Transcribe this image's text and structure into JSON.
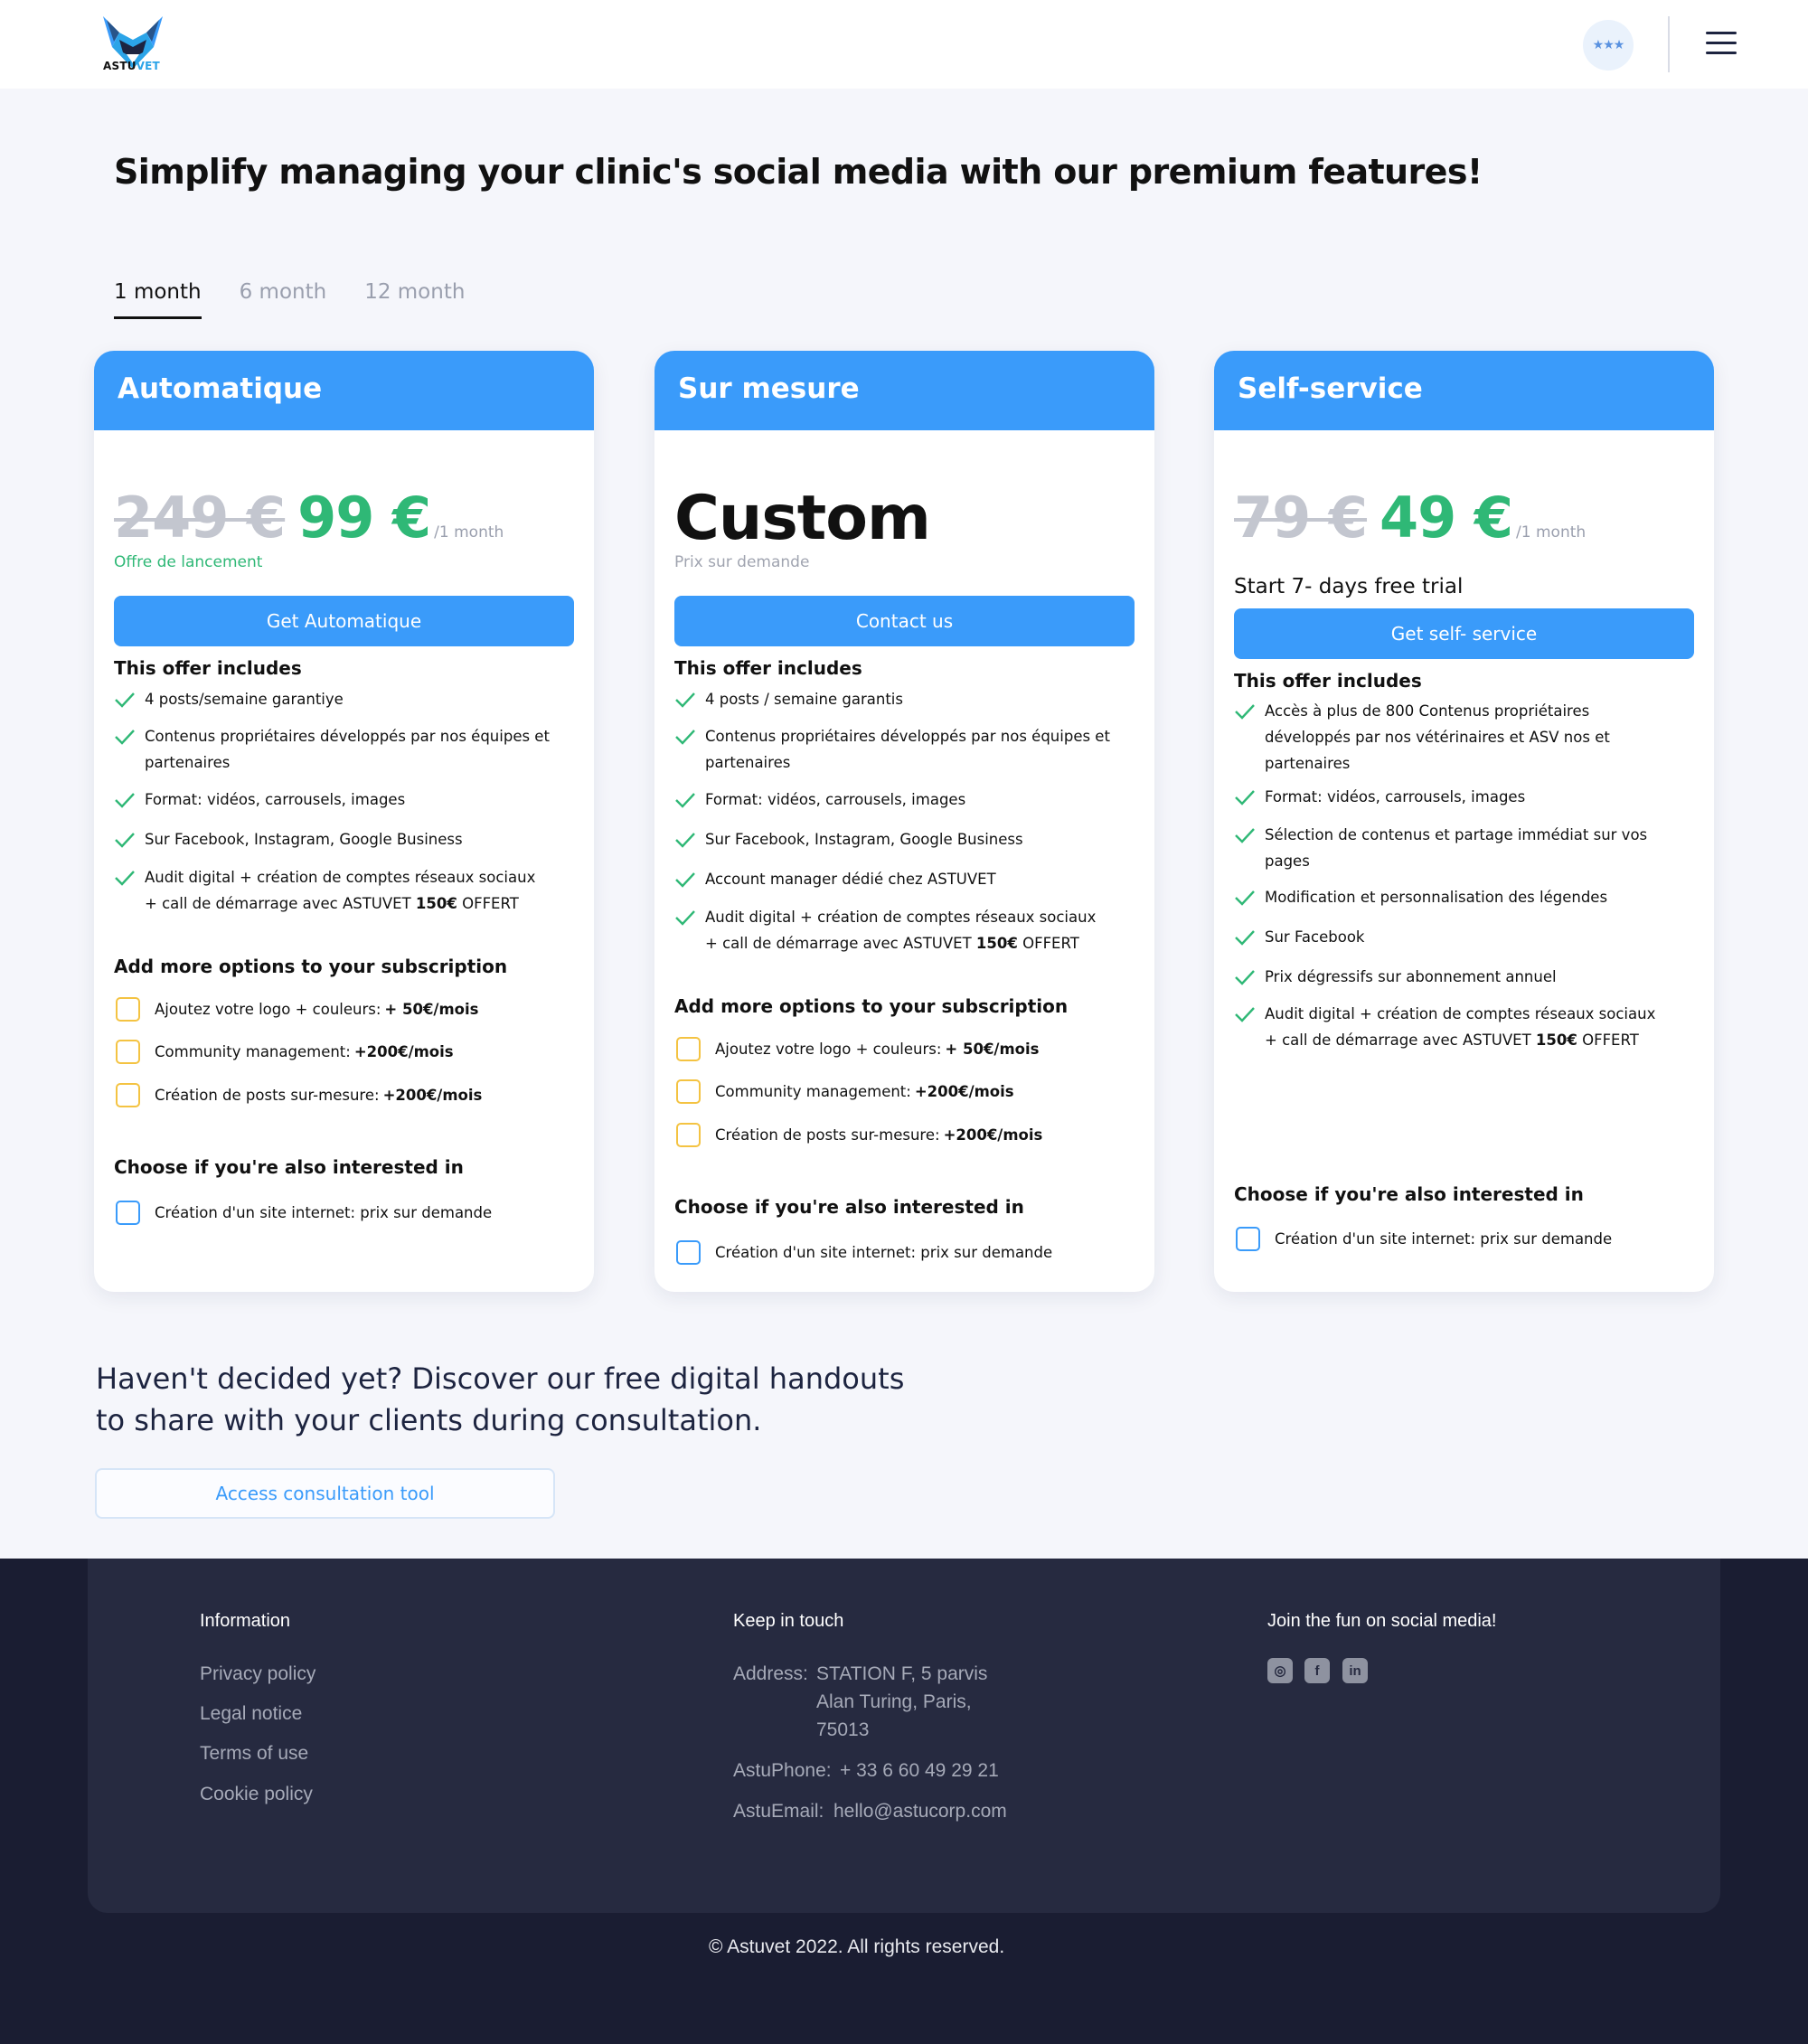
{
  "header": {
    "logo_prefix": "ASTU",
    "logo_suffix": "VET",
    "rating_stars": "★★★"
  },
  "title": "Simplify managing your clinic's social media with our premium features!",
  "tabs": [
    "1 month",
    "6 month",
    "12 month"
  ],
  "active_tab": 0,
  "colors": {
    "accent": "#3a9bfa",
    "price_green": "#2fb876",
    "option_yellow": "#f4c342",
    "footer_dark": "#1a1d32"
  },
  "plans": [
    {
      "name": "Automatique",
      "old_price": "249 €",
      "price": "99 €",
      "period": "/1 month",
      "note": "Offre de lancement",
      "cta": "Get Automatique",
      "includes_title": "This offer includes",
      "features": [
        [
          "4 posts/semaine garantiye"
        ],
        [
          "Contenus propriétaires développés par nos équipes et",
          "partenaires"
        ],
        [
          "Format: vidéos, carrousels, images"
        ],
        [
          "Sur Facebook, Instagram, Google Business"
        ],
        [
          "Audit digital + création de comptes réseaux sociaux",
          "+ call de démarrage avec ASTUVET "
        ]
      ],
      "feature_bold_tail": "150€",
      "feature_tail": " OFFERT",
      "options_title": "Add more options to your subscription",
      "options": [
        {
          "text": "Ajoutez votre logo + couleurs: ",
          "bold": "+ 50€/mois"
        },
        {
          "text": "Community management: ",
          "bold": "+200€/mois"
        },
        {
          "text": "Création de posts sur-mesure: ",
          "bold": "+200€/mois"
        }
      ],
      "interest_title": "Choose if you're  also interested in",
      "interest": "Création d'un site internet: prix sur demande"
    },
    {
      "name": "Sur mesure",
      "custom_price": "Custom",
      "note": "Prix sur demande",
      "cta": "Contact us",
      "includes_title": "This offer includes",
      "features": [
        [
          "4 posts / semaine garantis"
        ],
        [
          "Contenus propriétaires développés par nos équipes et",
          "partenaires"
        ],
        [
          "Format: vidéos, carrousels, images"
        ],
        [
          "Sur Facebook, Instagram, Google Business"
        ],
        [
          "Account manager dédié chez ASTUVET"
        ],
        [
          "Audit digital + création de comptes réseaux sociaux",
          "+ call de démarrage avec ASTUVET "
        ]
      ],
      "feature_bold_tail": "150€",
      "feature_tail": " OFFERT",
      "options_title": "Add more options to your subscription",
      "options": [
        {
          "text": "Ajoutez votre logo + couleurs: ",
          "bold": "+ 50€/mois"
        },
        {
          "text": "Community management: ",
          "bold": "+200€/mois"
        },
        {
          "text": "Création de posts sur-mesure: ",
          "bold": "+200€/mois"
        }
      ],
      "interest_title": "Choose if you're  also interested in",
      "interest": "Création d'un site internet: prix sur demande"
    },
    {
      "name": "Self-service",
      "old_price": "79 €",
      "price": "49 €",
      "period": "/1 month",
      "trial": "Start 7- days free trial",
      "cta": "Get self- service",
      "includes_title": "This offer includes",
      "features": [
        [
          "Accès à plus de 800 Contenus propriétaires",
          "développés par nos vétérinaires et ASV nos et",
          "partenaires"
        ],
        [
          "Format: vidéos, carrousels, images"
        ],
        [
          "Sélection de contenus et partage immédiat sur vos",
          "pages"
        ],
        [
          "Modification et personnalisation des légendes"
        ],
        [
          "Sur Facebook"
        ],
        [
          "Prix dégressifs sur abonnement annuel"
        ],
        [
          "Audit digital + création de comptes réseaux sociaux",
          "+ call de démarrage avec ASTUVET "
        ]
      ],
      "feature_bold_tail": "150€",
      "feature_tail": " OFFERT",
      "interest_title": "Choose if you're  also interested in",
      "interest": "Création d'un site internet: prix sur demande"
    }
  ],
  "help": {
    "line1": "Haven't decided yet? Discover our free digital handouts",
    "line2": "to share with your clients during consultation.",
    "button": "Access consultation tool"
  },
  "footer": {
    "info_title": "Information",
    "links": [
      "Privacy policy",
      "Legal notice",
      "Terms of use",
      "Cookie policy"
    ],
    "contact_title": "Keep in touch",
    "address_label": "Address:",
    "address_lines": [
      "STATION F, 5 parvis",
      "Alan Turing, Paris,",
      "75013"
    ],
    "phone_label": "AstuPhone:",
    "phone": "+ 33 6 60 49 29 21",
    "email_label": "AstuEmail:",
    "email": "hello@astucorp.com",
    "social_title": "Join the fun on social media!",
    "social_icons": [
      "instagram-icon",
      "facebook-icon",
      "linkedin-icon"
    ],
    "copyright": "Astuvet 2022. All rights reserved."
  }
}
